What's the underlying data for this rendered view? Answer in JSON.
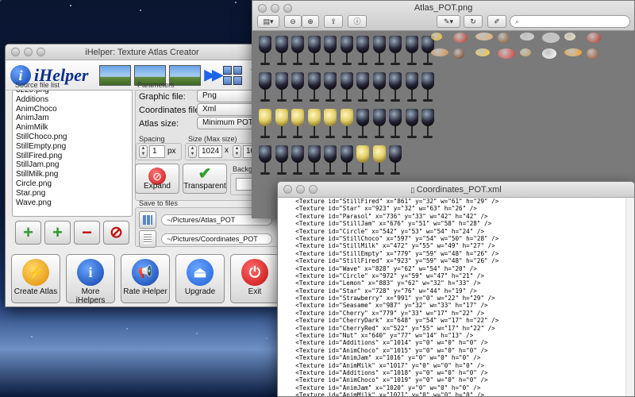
{
  "ihelper": {
    "title": "iHelper: Texture Atlas Creator",
    "logo_text": "iHelper",
    "banner_partial": "V",
    "source_list_label": "Source file list",
    "files": [
      "3220.png",
      "Additions",
      "AnimChoco",
      "AnimJam",
      "AnimMilk",
      "StillChoco.png",
      "StillEmpty.png",
      "StillFired.png",
      "StillJam.png",
      "StillMilk.png",
      "Circle.png",
      "Star.png",
      "Wave.png"
    ],
    "parameters_label": "Parameters",
    "graphic_file_label": "Graphic file:",
    "graphic_file_value": "Png",
    "coordinates_file_label": "Coordinates file:",
    "coordinates_file_value": "Xml",
    "atlas_size_label": "Atlas size:",
    "atlas_size_value": "Minimum POT siz",
    "spacing_label": "Spacing",
    "spacing_value": "1",
    "spacing_unit": "px",
    "size_label": "Size (Max size)",
    "size_w": "1024",
    "size_x": "x",
    "size_h": "1024",
    "background_label": "Backgro",
    "expand_label": "Expand",
    "transparent_label": "Transparent",
    "save_label": "Save to files",
    "save_atlas_path": "~/Pictures/Atlas_POT",
    "save_coords_path": "~/Pictures/Coordinates_POT",
    "actions": [
      {
        "label": "Create Atlas"
      },
      {
        "label": "More iHelpers"
      },
      {
        "label": "Rate iHelper"
      },
      {
        "label": "Upgrade"
      },
      {
        "label": "Exit"
      }
    ]
  },
  "preview": {
    "title": "Atlas_POT.png"
  },
  "xml": {
    "title": "Coordinates_POT.xml",
    "lines": [
      "    <Texture id=\"StillFired\" x=\"861\" y=\"32\" w=\"61\" h=\"29\" />",
      "    <Texture id=\"Star\" x=\"923\" y=\"32\" w=\"63\" h=\"26\" />",
      "    <Texture id=\"Parasol\" x=\"736\" y=\"33\" w=\"42\" h=\"42\" />",
      "    <Texture id=\"StillJam\" x=\"676\" y=\"51\" w=\"58\" h=\"28\" />",
      "    <Texture id=\"Circle\" x=\"542\" y=\"53\" w=\"54\" h=\"24\" />",
      "    <Texture id=\"StillChoco\" x=\"597\" y=\"54\" w=\"50\" h=\"28\" />",
      "    <Texture id=\"StillMilk\" x=\"472\" y=\"55\" w=\"49\" h=\"27\" />",
      "    <Texture id=\"StillEmpty\" x=\"779\" y=\"59\" w=\"48\" h=\"26\" />",
      "    <Texture id=\"StillFired\" x=\"923\" y=\"59\" w=\"48\" h=\"26\" />",
      "    <Texture id=\"Wave\" x=\"828\" y=\"62\" w=\"54\" h=\"20\" />",
      "    <Texture id=\"Circle\" x=\"972\" y=\"59\" w=\"47\" h=\"21\" />",
      "    <Texture id=\"Lemon\" x=\"883\" y=\"62\" w=\"32\" h=\"33\" />",
      "    <Texture id=\"Star\" x=\"728\" y=\"76\" w=\"44\" h=\"19\" />",
      "    <Texture id=\"Strawberry\" x=\"991\" y=\"0\" w=\"22\" h=\"29\" />",
      "    <Texture id=\"Seasame\" x=\"987\" y=\"32\" w=\"33\" h=\"17\" />",
      "    <Texture id=\"Cherry\" x=\"779\" y=\"33\" w=\"17\" h=\"22\" />",
      "    <Texture id=\"CherryDark\" x=\"648\" y=\"54\" w=\"17\" h=\"22\" />",
      "    <Texture id=\"CherryRed\" x=\"522\" y=\"55\" w=\"17\" h=\"22\" />",
      "    <Texture id=\"Nut\" x=\"640\" y=\"77\" w=\"14\" h=\"13\" />",
      "    <Texture id=\"Additions\" x=\"1014\" y=\"0\" w=\"0\" h=\"0\" />",
      "    <Texture id=\"AnimChoco\" x=\"1015\" y=\"0\" w=\"0\" h=\"0\" />",
      "    <Texture id=\"AnimJam\" x=\"1016\" y=\"0\" w=\"0\" h=\"0\" />",
      "    <Texture id=\"AnimMilk\" x=\"1017\" y=\"0\" w=\"0\" h=\"0\" />",
      "    <Texture id=\"Additions\" x=\"1018\" y=\"0\" w=\"0\" h=\"0\" />",
      "    <Texture id=\"AnimChoco\" x=\"1019\" y=\"0\" w=\"0\" h=\"0\" />",
      "    <Texture id=\"AnimJam\" x=\"1020\" y=\"0\" w=\"0\" h=\"0\" />",
      "    <Texture id=\"AnimMilk\" x=\"1021\" y=\"0\" w=\"0\" h=\"0\" />",
      "    <Texture id=\"Additions\" x=\"1022\" y=\"0\" w=\"0\" h=\"0\" />",
      "</Atlas>"
    ]
  },
  "colors": {
    "accent_blue": "#1e64e6",
    "create_orange": "#f0a000",
    "upgrade_blue": "#1f5fd6",
    "exit_red": "#d62020"
  },
  "icons": [
    "zoom-out-icon",
    "zoom-in-icon",
    "share-icon",
    "info-icon",
    "pen-icon",
    "search-icon",
    "plus-icon",
    "minus-icon",
    "no-icon",
    "check-icon"
  ]
}
